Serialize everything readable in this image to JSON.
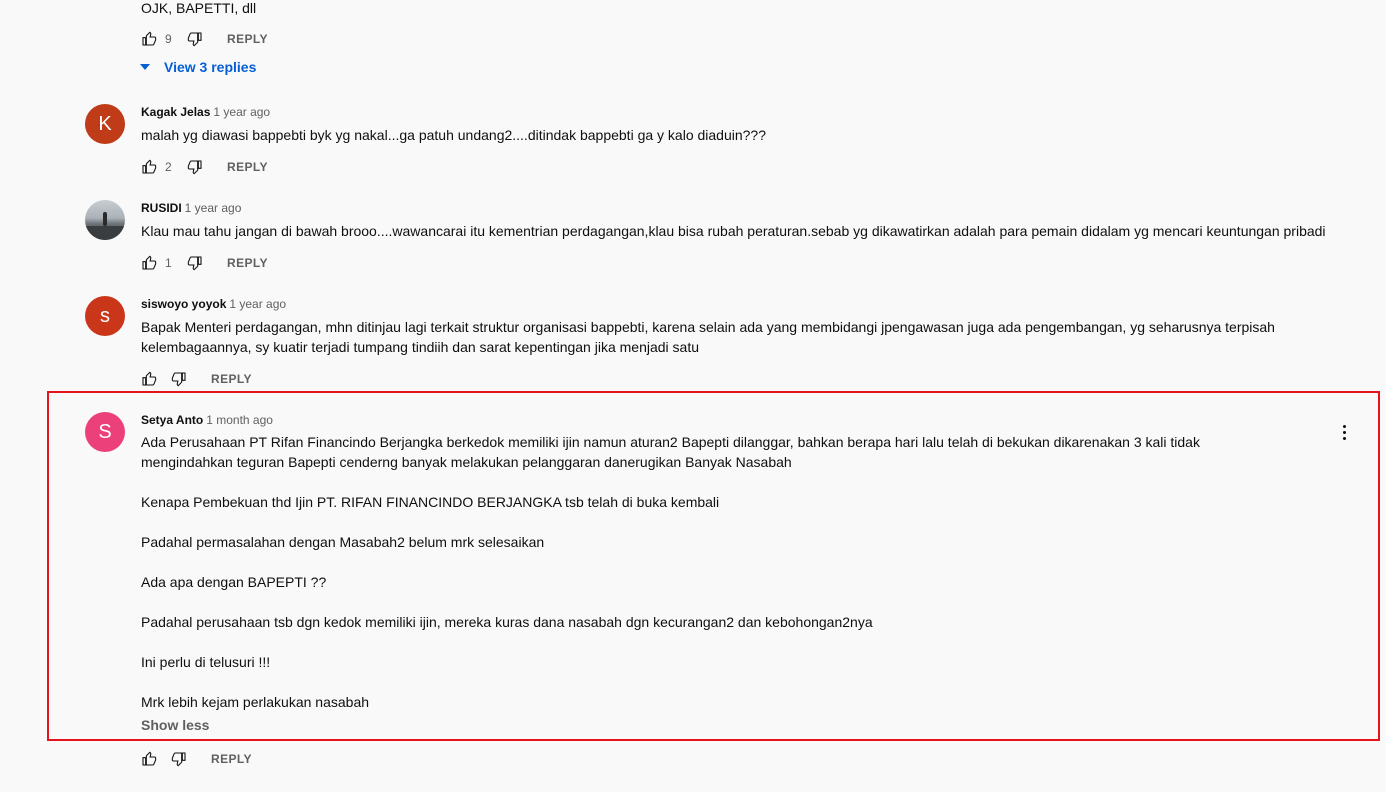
{
  "colors": {
    "avatar_kagak": "#c03b17",
    "avatar_siswoyo": "#c9361a",
    "avatar_setya": "#ec407a",
    "highlight_border": "#e5131c",
    "link_blue": "#065fd4"
  },
  "comments": [
    {
      "text_lines": [
        "OJK, BAPETTI, dll"
      ],
      "likes": "9",
      "reply_label": "REPLY",
      "view_replies": "View 3 replies"
    },
    {
      "author": "Kagak Jelas",
      "time": "1 year ago",
      "avatar_letter": "K",
      "text_lines": [
        "malah  yg diawasi bappebti   byk  yg nakal...ga patuh undang2....ditindak bappebti ga  y  kalo diaduin???"
      ],
      "likes": "2",
      "reply_label": "REPLY"
    },
    {
      "author": "RUSIDI",
      "time": "1 year ago",
      "text_lines": [
        "Klau mau tahu jangan di bawah brooo....wawancarai itu kementrian perdagangan,klau bisa rubah peraturan.sebab yg dikawatirkan adalah para pemain didalam yg mencari keuntungan pribadi"
      ],
      "likes": "1",
      "reply_label": "REPLY"
    },
    {
      "author": "siswoyo yoyok",
      "time": "1 year ago",
      "avatar_letter": "s",
      "text_lines": [
        "Bapak Menteri perdagangan,  mhn ditinjau lagi terkait struktur organisasi bappebti,  karena selain ada yang membidangi jpengawasan juga ada pengembangan,  yg seharusnya terpisah",
        "kelembagaannya,  sy kuatir terjadi tumpang tindiih dan sarat kepentingan jika menjadi satu"
      ],
      "likes": "",
      "reply_label": "REPLY"
    },
    {
      "author": "Setya Anto",
      "time": "1 month ago",
      "avatar_letter": "S",
      "paragraphs": [
        "Ada Perusahaan PT Rifan Financindo Berjangka berkedok memiliki ijin namun aturan2 Bapepti dilanggar, bahkan berapa hari lalu telah di bekukan dikarenakan 3 kali tidak mengindahkan teguran Bapepti cenderng banyak melakukan pelanggaran danerugikan Banyak Nasabah",
        "Kenapa Pembekuan thd Ijin PT. RIFAN FINANCINDO BERJANGKA tsb telah di buka kembali",
        "Padahal permasalahan dengan Masabah2 belum mrk selesaikan",
        "Ada apa dengan BAPEPTI ??",
        "Padahal perusahaan tsb dgn kedok memiliki ijin, mereka kuras dana nasabah dgn kecurangan2 dan kebohongan2nya",
        "Ini perlu di telusuri  !!!",
        "Mrk lebih kejam perlakukan nasabah"
      ],
      "show_less": "Show less",
      "likes": "",
      "reply_label": "REPLY"
    }
  ]
}
